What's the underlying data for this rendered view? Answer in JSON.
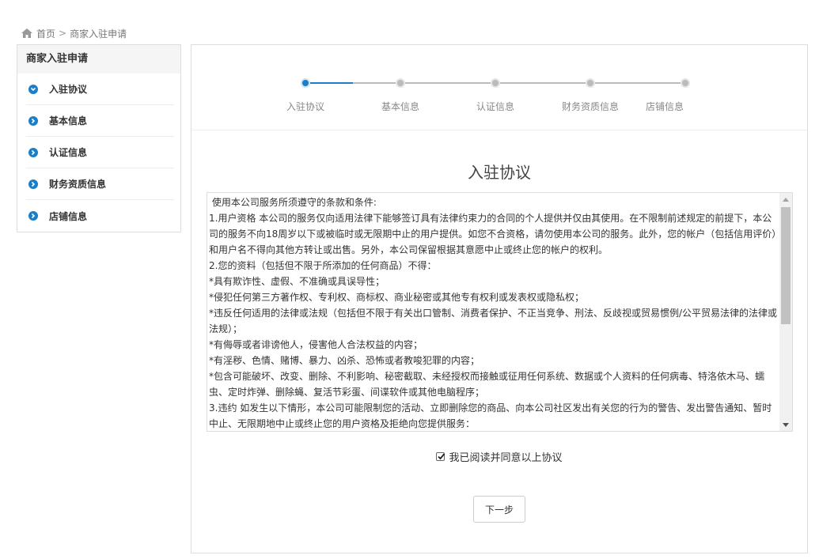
{
  "breadcrumb": {
    "home_icon": "home-icon",
    "home": "首页",
    "separator": ">",
    "current": "商家入驻申请"
  },
  "sidebar": {
    "title": "商家入驻申请",
    "items": [
      {
        "label": "入驻协议",
        "icon": "chevron-down-circle-icon",
        "active": true
      },
      {
        "label": "基本信息",
        "icon": "chevron-right-circle-icon",
        "active": false
      },
      {
        "label": "认证信息",
        "icon": "chevron-right-circle-icon",
        "active": false
      },
      {
        "label": "财务资质信息",
        "icon": "chevron-right-circle-icon",
        "active": false
      },
      {
        "label": "店铺信息",
        "icon": "chevron-right-circle-icon",
        "active": false
      }
    ]
  },
  "steps": {
    "current_index": 0,
    "items": [
      {
        "label": "入驻协议"
      },
      {
        "label": "基本信息"
      },
      {
        "label": "认证信息"
      },
      {
        "label": "财务资质信息"
      },
      {
        "label": "店铺信息"
      }
    ]
  },
  "agreement": {
    "title": "入驻协议",
    "lines": [
      " 使用本公司服务所须遵守的条款和条件:",
      "1.用户资格 本公司的服务仅向适用法律下能够签订具有法律约束力的合同的个人提供并仅由其使用。在不限制前述规定的前提下，本公司的服务不向18周岁以下或被临时或无限期中止的用户提供。如您不合资格，请勿使用本公司的服务。此外，您的帐户（包括信用评价）和用户名不得向其他方转让或出售。另外，本公司保留根据其意愿中止或终止您的帐户的权利。",
      "2.您的资料（包括但不限于所添加的任何商品）不得：",
      "*具有欺诈性、虚假、不准确或具误导性；",
      "*侵犯任何第三方著作权、专利权、商标权、商业秘密或其他专有权利或发表权或隐私权；",
      "*违反任何适用的法律或法规（包括但不限于有关出口管制、消费者保护、不正当竞争、刑法、反歧视或贸易惯例/公平贸易法律的法律或法规）；",
      "*有侮辱或者诽谤他人，侵害他人合法权益的内容；",
      "*有淫秽、色情、赌博、暴力、凶杀、恐怖或者教唆犯罪的内容；",
      "*包含可能破坏、改变、删除、不利影响、秘密截取、未经授权而接触或征用任何系统、数据或个人资料的任何病毒、特洛依木马、蠕虫、定时炸弹、删除蝇、复活节彩蛋、间谍软件或其他电脑程序；",
      "3.违约 如发生以下情形，本公司可能限制您的活动、立即删除您的商品、向本公司社区发出有关您的行为的警告、发出警告通知、暂时中止、无限期地中止或终止您的用户资格及拒绝向您提供服务："
    ],
    "agree_label": "我已阅读并同意以上协议",
    "agree_checked": true,
    "next_button": "下一步"
  },
  "colors": {
    "accent": "#1a7fc8",
    "inactive": "#bbbbbb",
    "border": "#dddddd"
  }
}
